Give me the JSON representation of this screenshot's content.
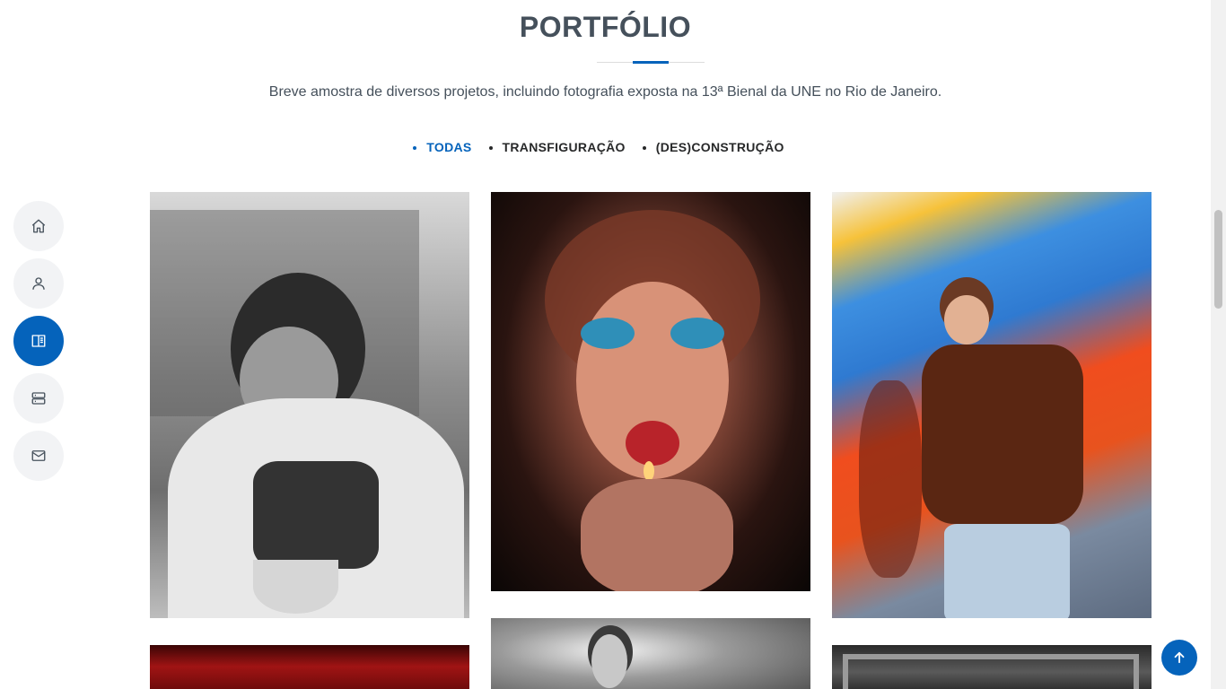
{
  "section": {
    "title": "PORTFÓLIO",
    "subtitle": "Breve amostra de diversos projetos, incluindo fotografia exposta na 13ª Bienal da UNE no Rio de Janeiro."
  },
  "filters": [
    {
      "label": "TODAS",
      "active": true
    },
    {
      "label": "TRANSFIGURAÇÃO",
      "active": false
    },
    {
      "label": "(DES)CONSTRUÇÃO",
      "active": false
    }
  ],
  "nav": [
    {
      "icon": "home-icon",
      "active": false
    },
    {
      "icon": "person-icon",
      "active": false
    },
    {
      "icon": "book-icon",
      "active": true
    },
    {
      "icon": "server-icon",
      "active": false
    },
    {
      "icon": "envelope-icon",
      "active": false
    }
  ],
  "gallery": [
    {
      "subject": "black-and-white portrait eating noodles"
    },
    {
      "subject": "portrait with blue eye makeup and lighter"
    },
    {
      "subject": "person in sunglasses against colorful wall"
    },
    {
      "subject": "red hair close-up"
    },
    {
      "subject": "black-and-white portrait with fur"
    },
    {
      "subject": "black-and-white framed interior"
    }
  ],
  "colors": {
    "accent": "#0563bb",
    "heading": "#45505b",
    "nav_bg": "#f2f3f5"
  },
  "back_to_top": {
    "icon": "arrow-up-icon"
  }
}
